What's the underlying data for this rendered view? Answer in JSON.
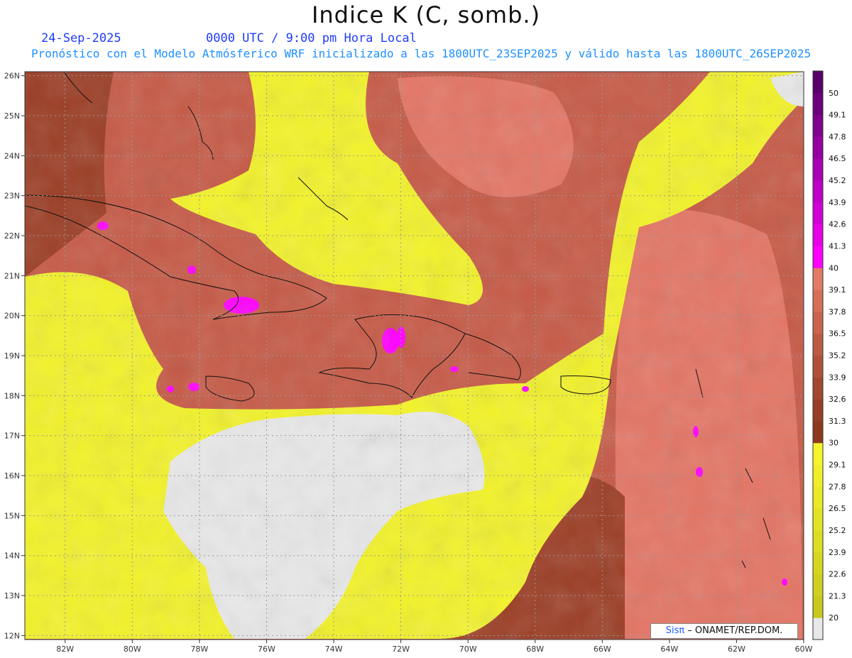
{
  "title": "Indice K (C, somb.)",
  "date": "24-Sep-2025",
  "time": "0000 UTC / 9:00 pm Hora Local",
  "subtitle": "Pronóstico con el Modelo Atmósferico WRF inicializado a las 1800UTC_23SEP2025 y válido hasta las  1800UTC_26SEP2025",
  "credit": {
    "logo": "Sisπ",
    "text": "– ONAMET/REP.DOM."
  },
  "map": {
    "lon_range": [
      -83.2,
      -60.0
    ],
    "lat_range": [
      11.9,
      26.1
    ],
    "lon_ticks": [
      {
        "value": -82,
        "label": "82W"
      },
      {
        "value": -80,
        "label": "80W"
      },
      {
        "value": -78,
        "label": "78W"
      },
      {
        "value": -76,
        "label": "76W"
      },
      {
        "value": -74,
        "label": "74W"
      },
      {
        "value": -72,
        "label": "72W"
      },
      {
        "value": -70,
        "label": "70W"
      },
      {
        "value": -68,
        "label": "68W"
      },
      {
        "value": -66,
        "label": "66W"
      },
      {
        "value": -64,
        "label": "64W"
      },
      {
        "value": -62,
        "label": "62W"
      },
      {
        "value": -60,
        "label": "60W"
      }
    ],
    "lat_ticks": [
      {
        "value": 26,
        "label": "26N"
      },
      {
        "value": 25,
        "label": "25N"
      },
      {
        "value": 24,
        "label": "24N"
      },
      {
        "value": 23,
        "label": "23N"
      },
      {
        "value": 22,
        "label": "22N"
      },
      {
        "value": 21,
        "label": "21N"
      },
      {
        "value": 20,
        "label": "20N"
      },
      {
        "value": 19,
        "label": "19N"
      },
      {
        "value": 18,
        "label": "18N"
      },
      {
        "value": 17,
        "label": "17N"
      },
      {
        "value": 16,
        "label": "16N"
      },
      {
        "value": 15,
        "label": "15N"
      },
      {
        "value": 14,
        "label": "14N"
      },
      {
        "value": 13,
        "label": "13N"
      },
      {
        "value": 12,
        "label": "12N"
      }
    ],
    "grid": true,
    "colors": {
      "low": "#e8e8e8",
      "yellow": "#f2f22a",
      "brown": "#a0442c",
      "salmon": "#e06a5a",
      "magenta": "#ff00ff"
    }
  },
  "colorbar": {
    "levels": [
      {
        "label": "",
        "color": "#e8e8e8"
      },
      {
        "label": "20",
        "color": "#c8c81e"
      },
      {
        "label": "21.3",
        "color": "#cfcf1f"
      },
      {
        "label": "22.6",
        "color": "#d6d621"
      },
      {
        "label": "23.9",
        "color": "#dcdc23"
      },
      {
        "label": "25.2",
        "color": "#e3e325"
      },
      {
        "label": "26.5",
        "color": "#e9e926"
      },
      {
        "label": "27.8",
        "color": "#efef28"
      },
      {
        "label": "29.1",
        "color": "#f4f42a"
      },
      {
        "label": "30",
        "color": "#8b3a1e"
      },
      {
        "label": "31.3",
        "color": "#973f26"
      },
      {
        "label": "32.6",
        "color": "#a3472f"
      },
      {
        "label": "33.9",
        "color": "#b05038"
      },
      {
        "label": "35.2",
        "color": "#bc5a42"
      },
      {
        "label": "36.5",
        "color": "#c9654d"
      },
      {
        "label": "37.8",
        "color": "#d66f58"
      },
      {
        "label": "39.1",
        "color": "#e27b66"
      },
      {
        "label": "40",
        "color": "#ff00ff"
      },
      {
        "label": "41.3",
        "color": "#e600e6"
      },
      {
        "label": "42.6",
        "color": "#d100d6"
      },
      {
        "label": "43.9",
        "color": "#bd00c4"
      },
      {
        "label": "45.2",
        "color": "#a800b2"
      },
      {
        "label": "46.5",
        "color": "#9400a0"
      },
      {
        "label": "47.8",
        "color": "#80008e"
      },
      {
        "label": "49.1",
        "color": "#6c007c"
      },
      {
        "label": "50",
        "color": "#58006a"
      }
    ]
  }
}
